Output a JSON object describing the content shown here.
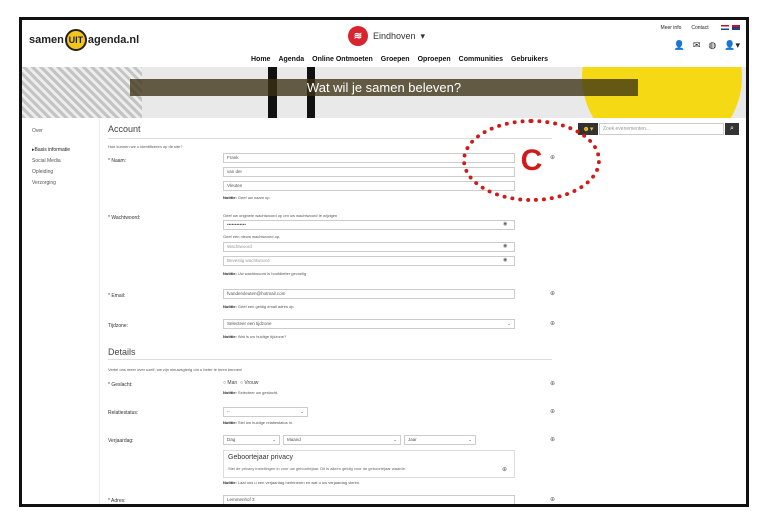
{
  "header": {
    "logo_left": "samen",
    "logo_mid": "UIT",
    "logo_right": "agenda.nl",
    "city": "Eindhoven",
    "meer_info": "Meer info",
    "contact": "Contact",
    "nav": [
      "Home",
      "Agenda",
      "Online Ontmoeten",
      "Groepen",
      "Oproepen",
      "Communities",
      "Gebruikers"
    ]
  },
  "banner": {
    "title": "Wat wil je samen beleven?"
  },
  "search": {
    "placeholder": "Zoek evenementen..."
  },
  "sidebar": {
    "over": "Over",
    "items": [
      "Basis informatie",
      "Social Media",
      "Opleiding",
      "Verzorging"
    ]
  },
  "account": {
    "heading": "Account",
    "question": "Hoe kunnen we u identificeren op de site?",
    "naam_label": "* Naam:",
    "voornaam": "Frank",
    "tussenvoegsel": "van der",
    "achternaam": "Vleuten",
    "naam_note_b": "Notitie:",
    "naam_note": "Geef uw naam op.",
    "ww_label": "* Wachtwoord:",
    "ww_hint": "Geef uw originele wachtwoord op om uw wachtwoord te wijzigen",
    "ww_value": "••••••••••••",
    "ww_new_hint": "Geef een nieuw wachtwoord op.",
    "ww_new_ph": "Wachtwoord",
    "ww_confirm_ph": "Bevestig wachtwoord",
    "ww_note": "Uw wachtwoord is hoofdletter gevoelig",
    "email_label": "* Email:",
    "email_value": "fvandervleuten@hotmail.com",
    "email_note": "Geef een geldig email adres op.",
    "tz_label": "Tijdzone:",
    "tz_value": "Selecteer een tijdzone",
    "tz_note": "Wat is uw huidige tijdzone?"
  },
  "details": {
    "heading": "Details",
    "question": "Vertel ons meer over uzelf, we zijn nieuwsgierig om u beter te leren kennen!",
    "gender_label": "* Geslacht:",
    "man": "Man",
    "vrouw": "Vrouw",
    "gender_note": "Selecteer uw geslacht.",
    "rel_label": "Relatiestatus:",
    "rel_value": "--",
    "rel_note": "Stel uw huidige relatiestatus in.",
    "bday_label": "Verjaardag:",
    "dag": "Dag",
    "maand": "Maand",
    "jaar": "Jaar",
    "priv_title": "Geboortejaar privacy",
    "priv_desc": "Stel de privacy instellingen in voor uw geboortejaar. Dit is alleen geldig voor de geboortejaar waarde.",
    "bday_note": "Laat ons u een verjaardag herinneren en wat u uw verjaardag vieren.",
    "adres_label": "* Adres:",
    "adres_value": "Lemmenhof 3"
  },
  "annotation": {
    "letter": "C"
  },
  "colors": {
    "accent_yellow": "#f5d914",
    "annotation_red": "#d11a1a",
    "city_red": "#d7242e"
  }
}
